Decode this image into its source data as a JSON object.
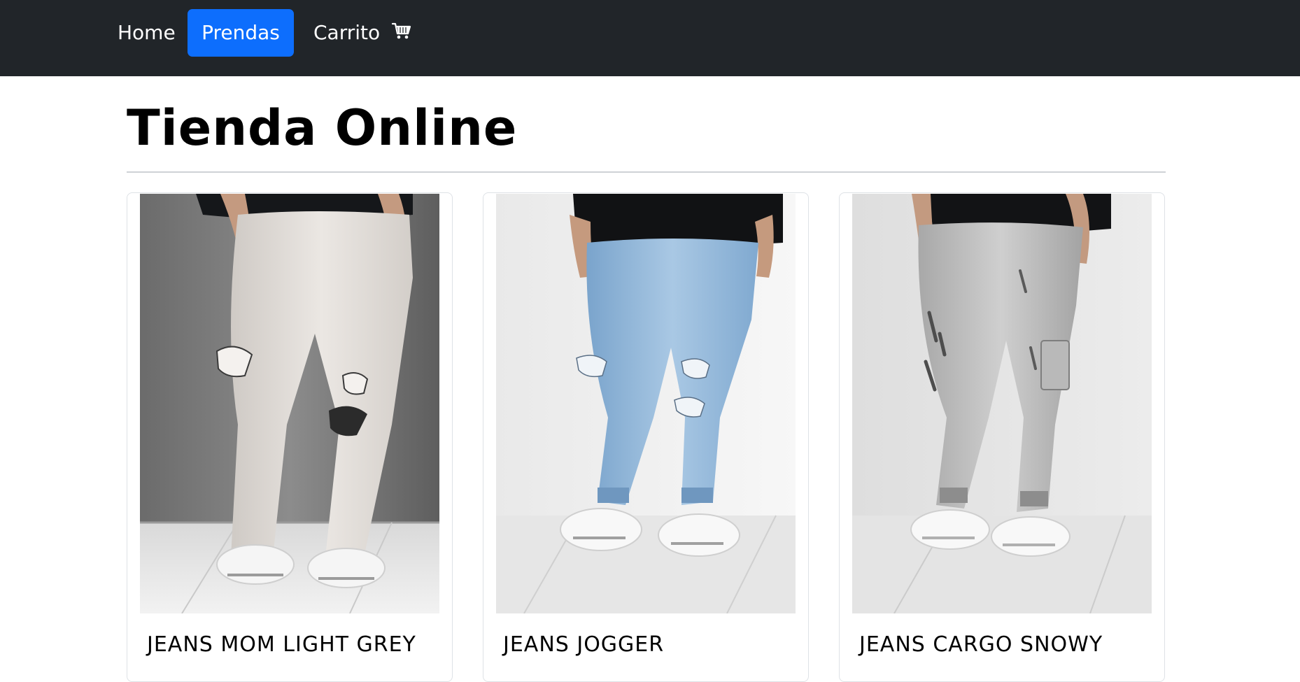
{
  "nav": {
    "items": [
      {
        "label": "Home",
        "active": false
      },
      {
        "label": "Prendas",
        "active": true
      },
      {
        "label": "Carrito",
        "active": false,
        "icon": "shopping-cart-icon"
      }
    ],
    "background": "#212529",
    "active_color": "#0d6efd"
  },
  "main": {
    "title": "Tienda Online",
    "products": [
      {
        "name": "JEANS MOM LIGHT GREY",
        "image": "light-grey-ripped-mom-jeans-photo"
      },
      {
        "name": "JEANS JOGGER",
        "image": "light-blue-ripped-jogger-jeans-photo"
      },
      {
        "name": "JEANS CARGO SNOWY",
        "image": "snowy-grey-cargo-jeans-photo"
      }
    ]
  }
}
